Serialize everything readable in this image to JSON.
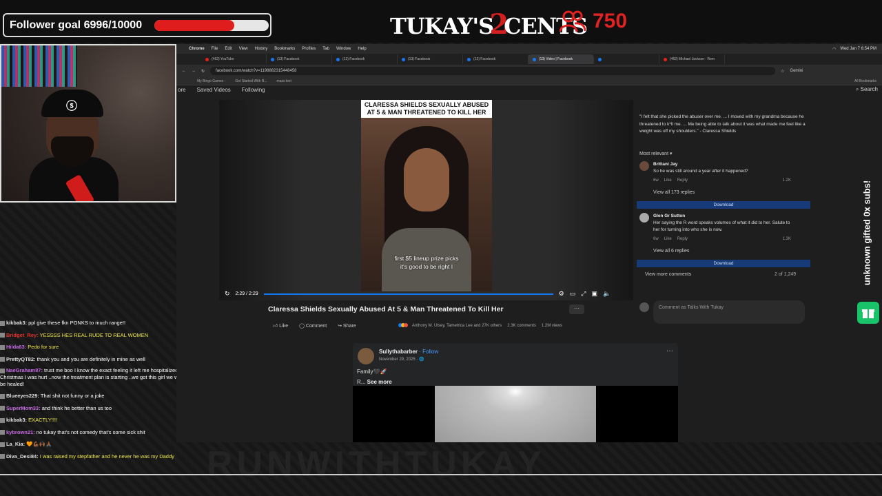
{
  "overlay": {
    "follower_goal_label": "Follower goal 6996/10000",
    "follower_goal_progress": 0.6996,
    "logo_left": "TUKAY'S",
    "logo_num": "2",
    "logo_right": "CENTS",
    "viewer_count": "750",
    "vertical_text": "unknown gifted 0x subs!",
    "watermark": "RUNWITHTUKAY"
  },
  "chat": [
    {
      "user": "kikbak3:",
      "msg": "ppl give these fkn PONKS to much range!!",
      "user_color": "#e0e0e0",
      "msg_color": "#ffffff"
    },
    {
      "user": "Bridget_Rey:",
      "msg": "YESSSS HES REAL RUDE TO REAL WOMEN",
      "user_color": "#e4342c",
      "msg_color": "#f1e84a"
    },
    {
      "user": "Hilda63:",
      "msg": "Pedo for sure",
      "user_color": "#c86ae6",
      "msg_color": "#f1e84a"
    },
    {
      "user": "PrettyQT82:",
      "msg": "thank you and you are definitely in mine as well",
      "user_color": "#e0e0e0",
      "msg_color": "#ffffff"
    },
    {
      "user": "NaeGraham87:",
      "msg": "trust me boo I know the exact feeling it left me hospitalized on Christmas I was hurt ..now the treatment plan is starting ..we got this girl we will be healed!",
      "user_color": "#c86ae6",
      "msg_color": "#ffffff"
    },
    {
      "user": "Blueeyes229:",
      "msg": "That shit not funny or a joke",
      "user_color": "#e0e0e0",
      "msg_color": "#ffffff"
    },
    {
      "user": "SuperMom33:",
      "msg": "and think he better than us too",
      "user_color": "#c86ae6",
      "msg_color": "#ffffff"
    },
    {
      "user": "kikbak3:",
      "msg": "EXACTLY!!!!",
      "user_color": "#e0e0e0",
      "msg_color": "#f1e84a"
    },
    {
      "user": "kybrown21:",
      "msg": "no tukay that's not comedy that's some sick shit",
      "user_color": "#c86ae6",
      "msg_color": "#ffffff"
    },
    {
      "user": "La_Kia:",
      "msg": "🧡💪🏾🙌🏾🙏🏾",
      "user_color": "#e0e0e0",
      "msg_color": "#ffffff"
    },
    {
      "user": "Diva_Desi84:",
      "msg": "I was raised my stepfather and he never he was my Daddy",
      "user_color": "#e0e0e0",
      "msg_color": "#f1e84a"
    }
  ],
  "browser": {
    "menus": [
      "Chrome",
      "File",
      "Edit",
      "View",
      "History",
      "Bookmarks",
      "Profiles",
      "Tab",
      "Window",
      "Help"
    ],
    "clock": "Wed Jan 7  6:54 PM",
    "tabs": [
      "(462) YouTube",
      "(13) Facebook",
      "(13) Facebook",
      "(13) Facebook",
      "(13) Facebook",
      "(13) Video | Facebook",
      "",
      "(462) Michael Jackson - Rem"
    ],
    "active_tab_index": 5,
    "url": "facebook.com/watch?v=1198882315448458",
    "bookmarks": [
      "My Bingo Games -",
      "Get Started With R...",
      "mass text"
    ],
    "all_bookmarks": "All Bookmarks",
    "nav": [
      "ore",
      "Saved Videos",
      "Following"
    ],
    "search_label": "Search",
    "profile_label": "Gemini"
  },
  "video": {
    "headline": "CLARESSA SHIELDS SEXUALLY ABUSED AT 5 & MAN THREATENED TO KILL HER",
    "caption_line1": "first $5 lineup prize picks",
    "caption_line2": "it's good to be right I",
    "time": "2:29 / 2:29",
    "title": "Claressa Shields Sexually Abused At 5 & Man Threatened To Kill Her",
    "like": "Like",
    "comment": "Comment",
    "share": "Share",
    "reactors": "Anthony M. Utsey, Tametrica Lee and 27K others",
    "comments_count": "2.3K comments",
    "views": "1.2M views"
  },
  "side": {
    "quote": "\"I felt that she picked the abuser over me. ... I moved with my grandma because he threatened to k*ll me. ... Me being able to talk about it was what made me feel like a weight was off my shoulders.\" - Claressa Shields",
    "sort": "Most relevant ▾",
    "comments": [
      {
        "name": "Brittani Jay",
        "text": "So he was still around a year after it happened?",
        "age": "6w",
        "like": "Like",
        "reply": "Reply",
        "count": "1.2K",
        "replies": "View all 173 replies"
      },
      {
        "name": "Glen Gr Sutton",
        "text": "Her saying the R word speaks volumes of what it did to her. Salute to her for turning into who she is now.",
        "age": "6w",
        "like": "Like",
        "reply": "Reply",
        "count": "1.3K",
        "replies": "View all 6 replies"
      }
    ],
    "download": "Download",
    "view_more": "View more comments",
    "page_of": "2 of 1,249",
    "compose_placeholder": "Comment as Talks With Tukay"
  },
  "post": {
    "author": "Sullythabarber",
    "follow": "· Follow",
    "date": "November 29, 2025 · 🌐",
    "text": "Family🖤🚀",
    "prefix": "R... ",
    "see_more": "See more"
  }
}
